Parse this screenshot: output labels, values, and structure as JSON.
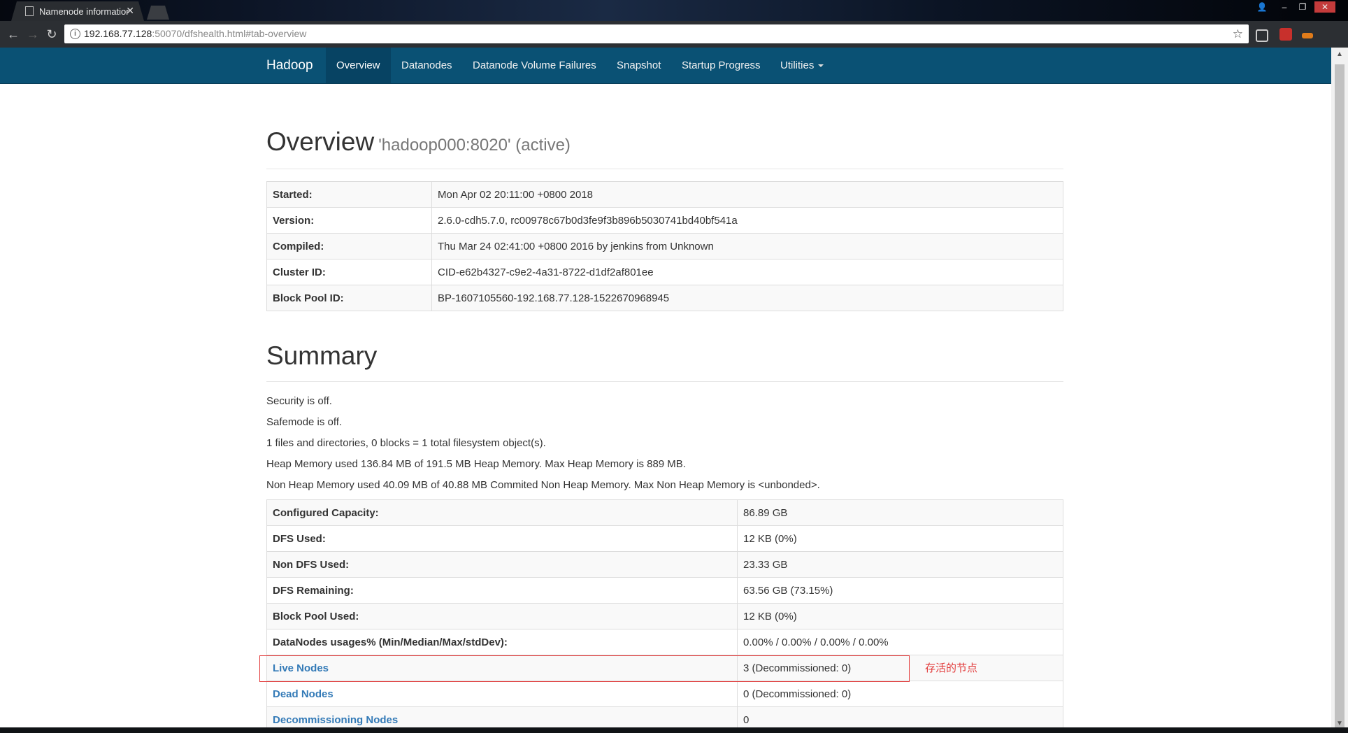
{
  "browser": {
    "tab_title": "Namenode information",
    "url_host": "192.168.77.128",
    "url_rest": ":50070/dfshealth.html#tab-overview"
  },
  "navbar": {
    "brand": "Hadoop",
    "items": [
      {
        "label": "Overview",
        "active": true
      },
      {
        "label": "Datanodes"
      },
      {
        "label": "Datanode Volume Failures"
      },
      {
        "label": "Snapshot"
      },
      {
        "label": "Startup Progress"
      },
      {
        "label": "Utilities"
      }
    ]
  },
  "overview": {
    "title": "Overview",
    "subtitle": "'hadoop000:8020' (active)",
    "rows": [
      {
        "key": "Started:",
        "value": "Mon Apr 02 20:11:00 +0800 2018"
      },
      {
        "key": "Version:",
        "value": "2.6.0-cdh5.7.0, rc00978c67b0d3fe9f3b896b5030741bd40bf541a"
      },
      {
        "key": "Compiled:",
        "value": "Thu Mar 24 02:41:00 +0800 2016 by jenkins from Unknown"
      },
      {
        "key": "Cluster ID:",
        "value": "CID-e62b4327-c9e2-4a31-8722-d1df2af801ee"
      },
      {
        "key": "Block Pool ID:",
        "value": "BP-1607105560-192.168.77.128-1522670968945"
      }
    ]
  },
  "summary": {
    "title": "Summary",
    "lines": [
      "Security is off.",
      "Safemode is off.",
      "1 files and directories, 0 blocks = 1 total filesystem object(s).",
      "Heap Memory used 136.84 MB of 191.5 MB Heap Memory. Max Heap Memory is 889 MB.",
      "Non Heap Memory used 40.09 MB of 40.88 MB Commited Non Heap Memory. Max Non Heap Memory is <unbonded>."
    ],
    "rows": [
      {
        "key": "Configured Capacity:",
        "value": "86.89 GB"
      },
      {
        "key": "DFS Used:",
        "value": "12 KB (0%)"
      },
      {
        "key": "Non DFS Used:",
        "value": "23.33 GB"
      },
      {
        "key": "DFS Remaining:",
        "value": "63.56 GB (73.15%)"
      },
      {
        "key": "Block Pool Used:",
        "value": "12 KB (0%)"
      },
      {
        "key": "DataNodes usages% (Min/Median/Max/stdDev):",
        "value": "0.00% / 0.00% / 0.00% / 0.00%"
      },
      {
        "key": "Live Nodes",
        "value": "3 (Decommissioned: 0)",
        "link": true
      },
      {
        "key": "Dead Nodes",
        "value": "0 (Decommissioned: 0)",
        "link": true
      },
      {
        "key": "Decommissioning Nodes",
        "value": "0",
        "link": true
      }
    ]
  },
  "annotation": "存活的节点",
  "colors": {
    "navbar": "#0a5174",
    "annotation": "#e23b3b",
    "link": "#337ab7"
  }
}
